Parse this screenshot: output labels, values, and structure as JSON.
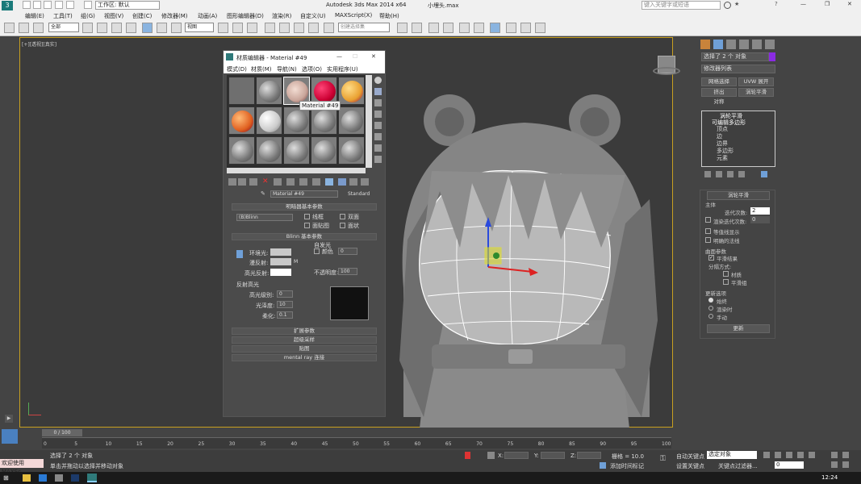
{
  "window": {
    "workspace_label": "工作区: 默认",
    "app_title": "Autodesk 3ds Max  2014 x64",
    "file_name": "小埋头.max",
    "search_placeholder": "键入关键字或短语"
  },
  "menu": [
    "编辑(E)",
    "工具(T)",
    "组(G)",
    "视图(V)",
    "创建(C)",
    "修改器(M)",
    "动画(A)",
    "图形编辑器(D)",
    "渲染(R)",
    "自定义(U)",
    "MAXScript(X)",
    "帮助(H)"
  ],
  "toolbar": {
    "selection_filter": "全部",
    "ref_coord": "视图",
    "named_selection": "创建选择集"
  },
  "viewport": {
    "label": "[+][透视][真实]"
  },
  "material_editor": {
    "title": "材质编辑器 - Material #49",
    "menu": [
      "模式(D)",
      "材质(M)",
      "导航(N)",
      "选项(O)",
      "实用程序(U)"
    ],
    "tooltip": "Material #49",
    "material_name": "Material #49",
    "material_type": "Standard",
    "shader_rollout_title": "明暗器基本参数",
    "shader_type": "(B)Blinn",
    "shader_options": [
      "线框",
      "双面",
      "面贴图",
      "面状"
    ],
    "blinn_rollout_title": "Blinn 基本参数",
    "self_illum_label": "自发光",
    "color_label": "颜色",
    "color_value": "0",
    "ambient_label": "环境光:",
    "diffuse_label": "漫反射:",
    "specular_label": "高光反射:",
    "opacity_label": "不透明度:",
    "opacity_value": "100",
    "spec_highlights_label": "反射高光",
    "spec_level_label": "高光级别:",
    "spec_level_value": "0",
    "gloss_label": "光泽度:",
    "gloss_value": "10",
    "soften_label": "柔化:",
    "soften_value": "0.1",
    "collapsed_rollouts": [
      "扩展参数",
      "超级采样",
      "贴图",
      "mental ray 连接"
    ]
  },
  "command_panel": {
    "selection_text": "选择了 2 个 对象",
    "modifier_list": "修改器列表",
    "buttons": [
      "网格选择",
      "UVW 展开",
      "挤出",
      "涡轮平滑",
      "对称"
    ],
    "stack": [
      "涡轮平滑",
      "可编辑多边形",
      "顶点",
      "边",
      "边界",
      "多边形",
      "元素"
    ],
    "turbosmooth_title": "涡轮平滑",
    "main_label": "主体",
    "iterations_label": "迭代次数:",
    "iterations_value": "2",
    "render_iters_label": "渲染迭代次数:",
    "render_iters_value": "0",
    "isoline_label": "等值线显示",
    "explicit_normals_label": "明确的法线",
    "surface_params_label": "曲面参数",
    "smooth_result_label": "平滑结果",
    "separate_by_label": "分隔方式:",
    "materials_label": "材质",
    "smoothing_groups_label": "平滑组",
    "update_options_label": "更新选项",
    "always_label": "始终",
    "when_rendering_label": "渲染时",
    "manually_label": "手动",
    "update_button": "更新"
  },
  "timeline": {
    "frame_display": "0 / 100",
    "ticks": [
      "0",
      "5",
      "10",
      "15",
      "20",
      "25",
      "30",
      "35",
      "40",
      "45",
      "50",
      "55",
      "60",
      "65",
      "70",
      "75",
      "80",
      "85",
      "90",
      "95",
      "100"
    ]
  },
  "status": {
    "welcome": "欢迎使用 MAXSc",
    "selected_text": "选择了 2 个 对象",
    "prompt_text": "单击并拖动以选择并移动对象",
    "x_label": "X:",
    "y_label": "Y:",
    "z_label": "Z:",
    "grid_text": "栅格 = 10.0",
    "add_time_tag": "添加时间标记",
    "auto_key": "自动关键点",
    "set_key": "设置关键点",
    "selected_object": "选定对象",
    "key_filters": "关键点过滤器...",
    "frame_value": "0"
  },
  "taskbar": {
    "time": "12:24"
  }
}
